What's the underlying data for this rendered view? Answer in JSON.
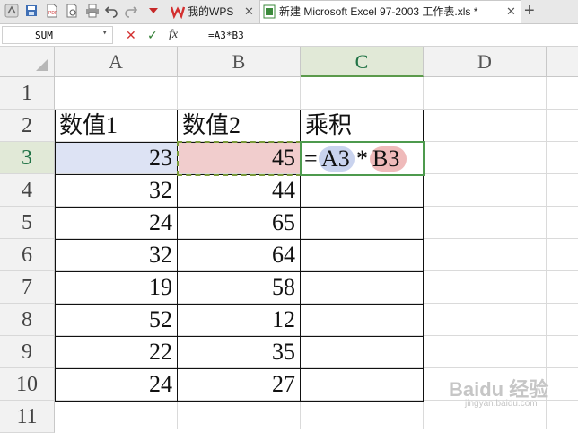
{
  "toolbar": {
    "icons": [
      "app-logo-icon",
      "save-icon",
      "export-pdf-icon",
      "print-preview-icon",
      "print-icon",
      "undo-icon",
      "redo-icon",
      "customize-dropdown-icon"
    ]
  },
  "tabs": [
    {
      "label": "我的WPS",
      "close": "✕",
      "icon": "wps-logo-icon"
    },
    {
      "label": "新建 Microsoft Excel 97-2003 工作表.xls *",
      "close": "✕",
      "icon": "spreadsheet-file-icon"
    }
  ],
  "new_tab": "+",
  "formula_bar": {
    "name_box": "SUM",
    "cancel": "✕",
    "confirm": "✓",
    "fx": "fx",
    "formula": "=A3*B3"
  },
  "columns": [
    "A",
    "B",
    "C",
    "D"
  ],
  "rows": [
    "1",
    "2",
    "3",
    "4",
    "5",
    "6",
    "7",
    "8",
    "9",
    "10",
    "11"
  ],
  "cells": {
    "A2": "数值1",
    "B2": "数值2",
    "C2": "乘积",
    "A3": "23",
    "B3": "45",
    "A4": "32",
    "B4": "44",
    "A5": "24",
    "B5": "65",
    "A6": "32",
    "B6": "64",
    "A7": "19",
    "B7": "58",
    "A8": "52",
    "B8": "12",
    "A9": "22",
    "B9": "35",
    "A10": "24",
    "B10": "27"
  },
  "editing": {
    "eq": "=",
    "ref1": "A3",
    "op": "*",
    "ref2": "B3"
  },
  "watermark": {
    "brand": "Baidu 经验",
    "url": "jingyan.baidu.com"
  },
  "colors": {
    "accent_green": "#217346",
    "ref_blue": "#c9d3ee",
    "ref_red": "#efbaba"
  }
}
